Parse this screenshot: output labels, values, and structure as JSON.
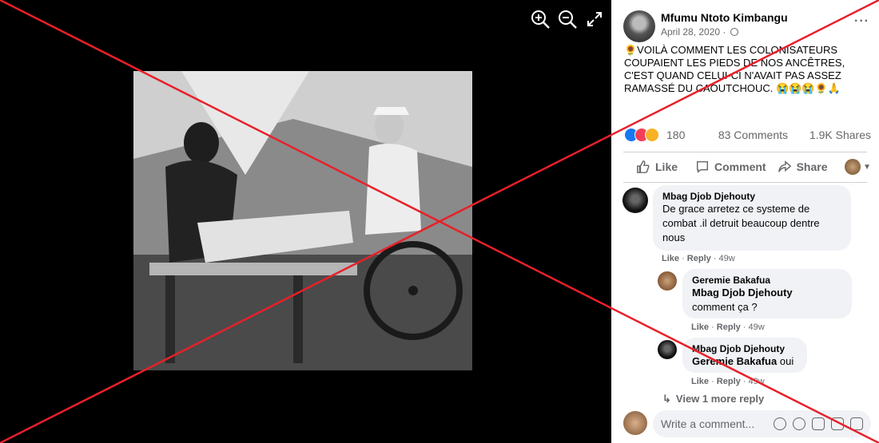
{
  "viewer": {
    "zoom_in_icon": "zoom-in-icon",
    "zoom_out_icon": "zoom-out-icon",
    "fullscreen_icon": "fullscreen-icon"
  },
  "post": {
    "author": "Mfumu Ntoto Kimbangu",
    "date": "April 28, 2020 ·",
    "text": "🌻VOILÀ COMMENT LES COLONISATEURS COUPAIENT LES PIEDS DE NOS ANCÊTRES, C'EST QUAND CELUI-CI N'AVAIT PAS ASSEZ RAMASSÉ DU CAOUTCHOUC. 😭😭😭🌻🙏",
    "reaction_count": "180",
    "comment_count": "83 Comments",
    "share_count": "1.9K Shares",
    "more_label": "···"
  },
  "actions": {
    "like": "Like",
    "comment": "Comment",
    "share": "Share"
  },
  "comments": [
    {
      "name": "Mbag Djob Djehouty",
      "text": "De grace arretez ce systeme de combat .il detruit beaucoup dentre nous",
      "like": "Like",
      "reply": "Reply",
      "time": "49w"
    },
    {
      "name": "Geremie Bakafua",
      "tag": "Mbag Djob Djehouty",
      "text": "comment ça ?",
      "like": "Like",
      "reply": "Reply",
      "time": "49w"
    },
    {
      "name": "Mbag Djob Djehouty",
      "tag": "Geremie Bakafua",
      "text": "oui",
      "like": "Like",
      "reply": "Reply",
      "time": "49w"
    }
  ],
  "view_more": "View 1 more reply",
  "write_placeholder": "Write a comment...",
  "colors": {
    "overlay_x": "#e8202a",
    "like_blue": "#1877f2"
  }
}
